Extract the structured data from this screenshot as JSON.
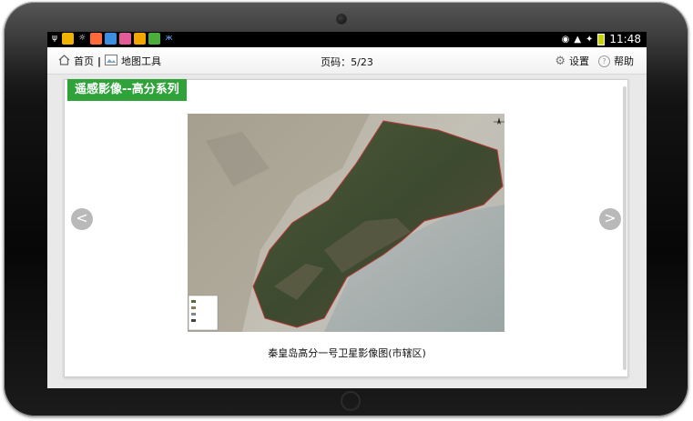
{
  "status_bar": {
    "time": "11:48"
  },
  "nav": {
    "home_label": "首页",
    "separator": "|",
    "map_tools_label": "地图工具",
    "page_indicator": "页码：5/23",
    "settings_label": "设置",
    "help_label": "帮助"
  },
  "content": {
    "section_title": "遥感影像--高分系列",
    "image_caption": "秦皇岛高分一号卫星影像图(市辖区)",
    "prev_label": "<",
    "next_label": ">"
  },
  "colors": {
    "title_bg": "#2fa23a",
    "status_bar": "#000000",
    "sea": "#a9b2b0"
  }
}
